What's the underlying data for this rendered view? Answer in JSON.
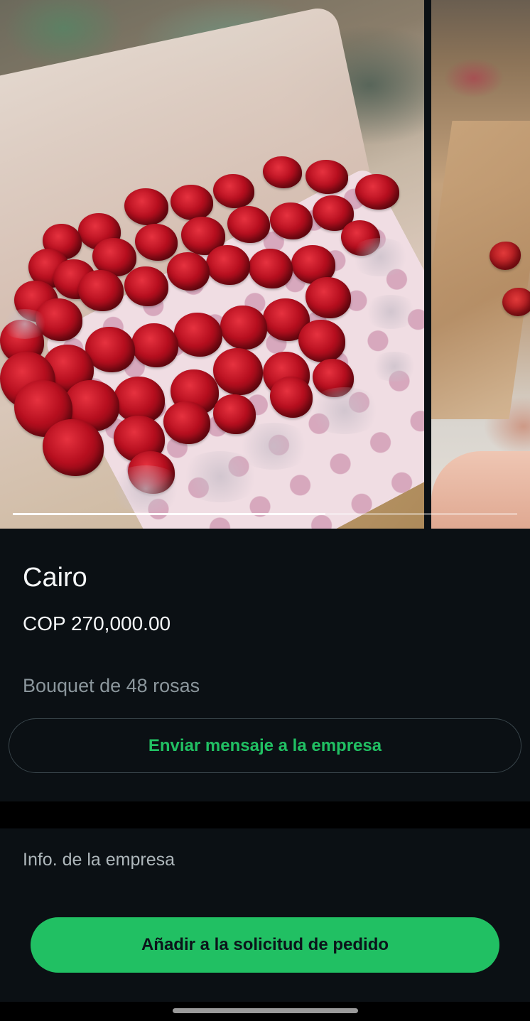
{
  "carousel": {
    "current_index": 1,
    "total_images": 2,
    "progress_fraction": 0.62
  },
  "product": {
    "name": "Cairo",
    "price": "COP 270,000.00",
    "description": "Bouquet de 48 rosas"
  },
  "actions": {
    "message_label": "Enviar mensaje a la empresa",
    "company_info_label": "Info. de la empresa",
    "add_to_order_label": "Añadir a la solicitud de pedido"
  },
  "colors": {
    "accent": "#21c063",
    "background": "#0b1014",
    "text_primary": "#f5f7f8",
    "text_secondary": "#8b969c"
  }
}
